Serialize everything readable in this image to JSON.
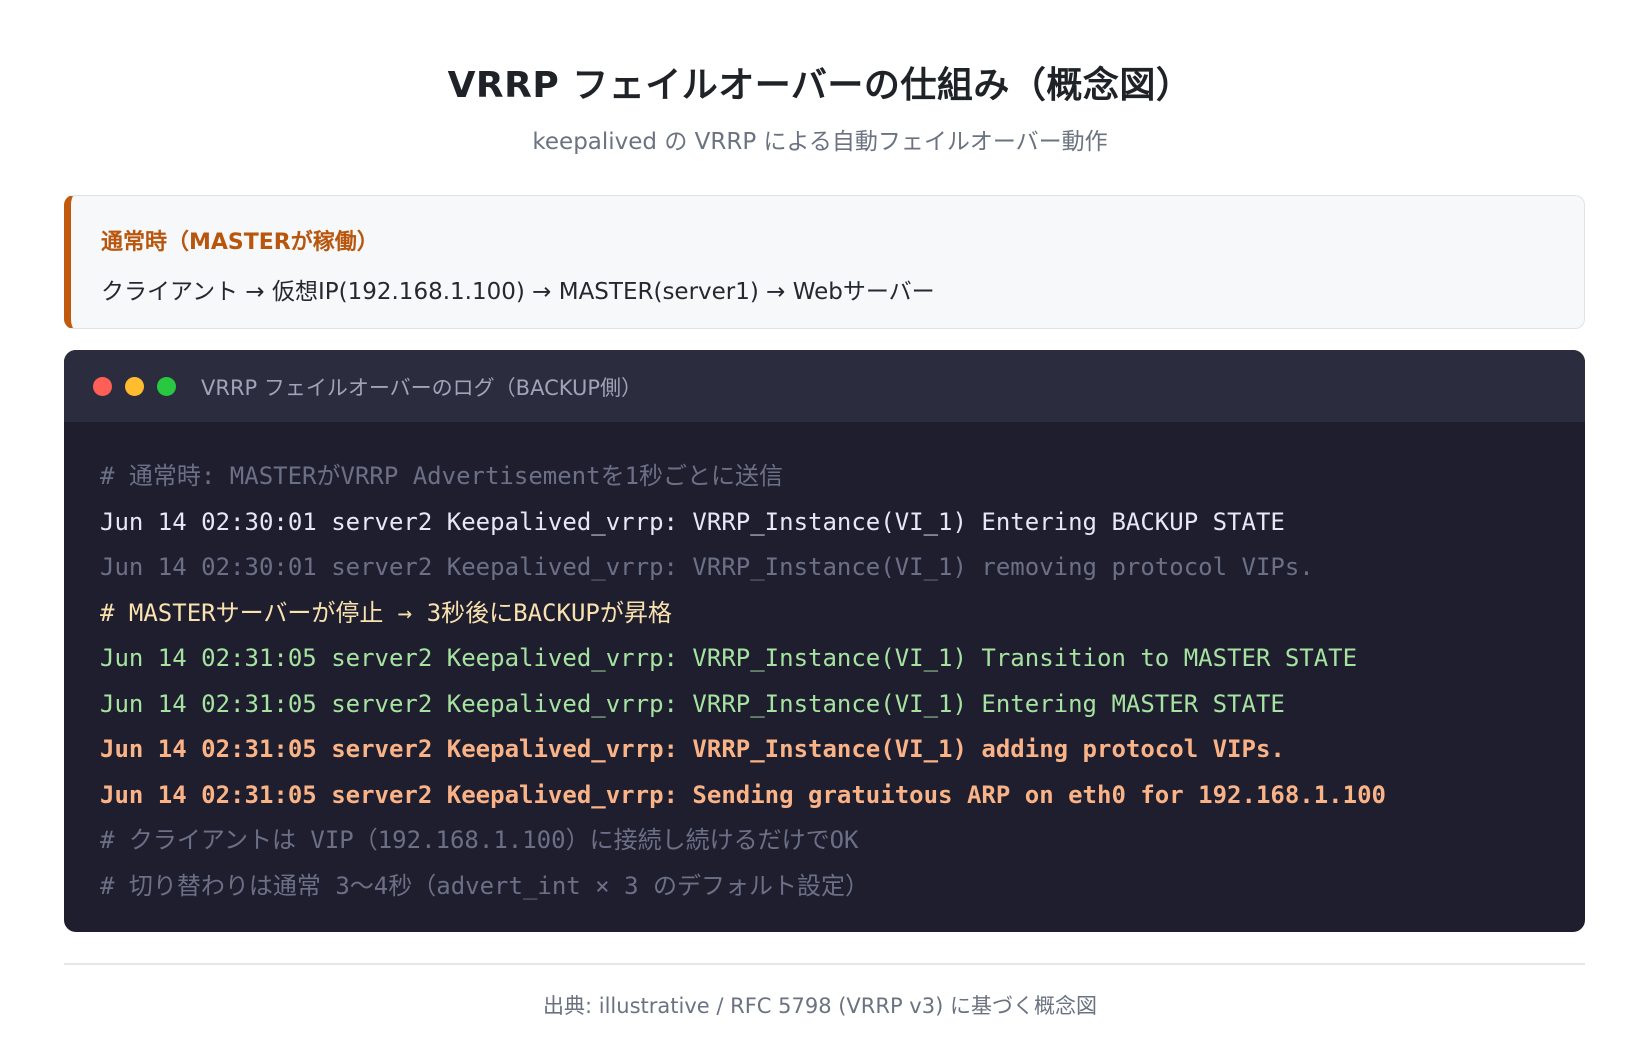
{
  "header": {
    "title": "VRRP フェイルオーバーの仕組み（概念図）",
    "subtitle": "keepalived の VRRP による自動フェイルオーバー動作"
  },
  "callout": {
    "heading": "通常時（MASTERが稼働）",
    "body": "クライアント → 仮想IP(192.168.1.100) → MASTER(server1) → Webサーバー",
    "accent_color": "#c05a0c"
  },
  "terminal": {
    "title": "VRRP フェイルオーバーのログ（BACKUP側）",
    "window_buttons": [
      "close",
      "minimize",
      "maximize"
    ],
    "lines": [
      {
        "text": "# 通常時: MASTERがVRRP Advertisementを1秒ごとに送信",
        "style": "comment"
      },
      {
        "text": "Jun 14 02:30:01 server2 Keepalived_vrrp: VRRP_Instance(VI_1) Entering BACKUP STATE",
        "style": "normal"
      },
      {
        "text": "Jun 14 02:30:01 server2 Keepalived_vrrp: VRRP_Instance(VI_1) removing protocol VIPs.",
        "style": "dim"
      },
      {
        "text": "# MASTERサーバーが停止 → 3秒後にBACKUPが昇格",
        "style": "yellow"
      },
      {
        "text": "Jun 14 02:31:05 server2 Keepalived_vrrp: VRRP_Instance(VI_1) Transition to MASTER STATE",
        "style": "green"
      },
      {
        "text": "Jun 14 02:31:05 server2 Keepalived_vrrp: VRRP_Instance(VI_1) Entering MASTER STATE",
        "style": "green"
      },
      {
        "text": "Jun 14 02:31:05 server2 Keepalived_vrrp: VRRP_Instance(VI_1) adding protocol VIPs.",
        "style": "orange"
      },
      {
        "text": "Jun 14 02:31:05 server2 Keepalived_vrrp: Sending gratuitous ARP on eth0 for 192.168.1.100",
        "style": "orange"
      },
      {
        "text": "# クライアントは VIP（192.168.1.100）に接続し続けるだけでOK",
        "style": "comment"
      },
      {
        "text": "# 切り替わりは通常 3〜4秒（advert_int × 3 のデフォルト設定）",
        "style": "comment"
      }
    ]
  },
  "footer": {
    "source": "出典: illustrative / RFC 5798 (VRRP v3) に基づく概念図"
  }
}
